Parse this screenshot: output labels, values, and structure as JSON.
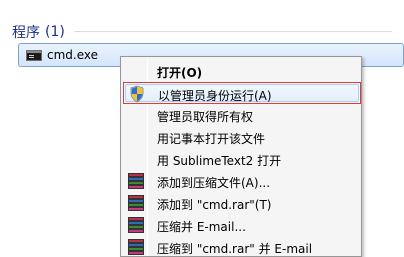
{
  "search_results": {
    "section_title": "程序",
    "section_count": "(1)",
    "items": [
      {
        "label": "cmd.exe",
        "icon": "cmd-icon"
      }
    ]
  },
  "context_menu": {
    "items": [
      {
        "label": "打开(O)",
        "bold": true,
        "icon": null
      },
      {
        "label": "以管理员身份运行(A)",
        "icon": "uac-shield-icon",
        "highlighted": true
      },
      {
        "label": "管理员取得所有权",
        "icon": null
      },
      {
        "label": "用记事本打开该文件",
        "icon": null
      },
      {
        "label": "用 SublimeText2 打开",
        "icon": null
      },
      {
        "label": "添加到压缩文件(A)...",
        "icon": "winrar-icon"
      },
      {
        "label": "添加到 \"cmd.rar\"(T)",
        "icon": "winrar-icon"
      },
      {
        "label": "压缩并 E-mail...",
        "icon": "winrar-icon"
      },
      {
        "label": "压缩到 \"cmd.rar\" 并 E-mail",
        "icon": "winrar-icon"
      }
    ]
  },
  "colors": {
    "section_title": "#1e3287",
    "highlight_border": "#e03a3a",
    "selection_fill": "#e4effd"
  }
}
